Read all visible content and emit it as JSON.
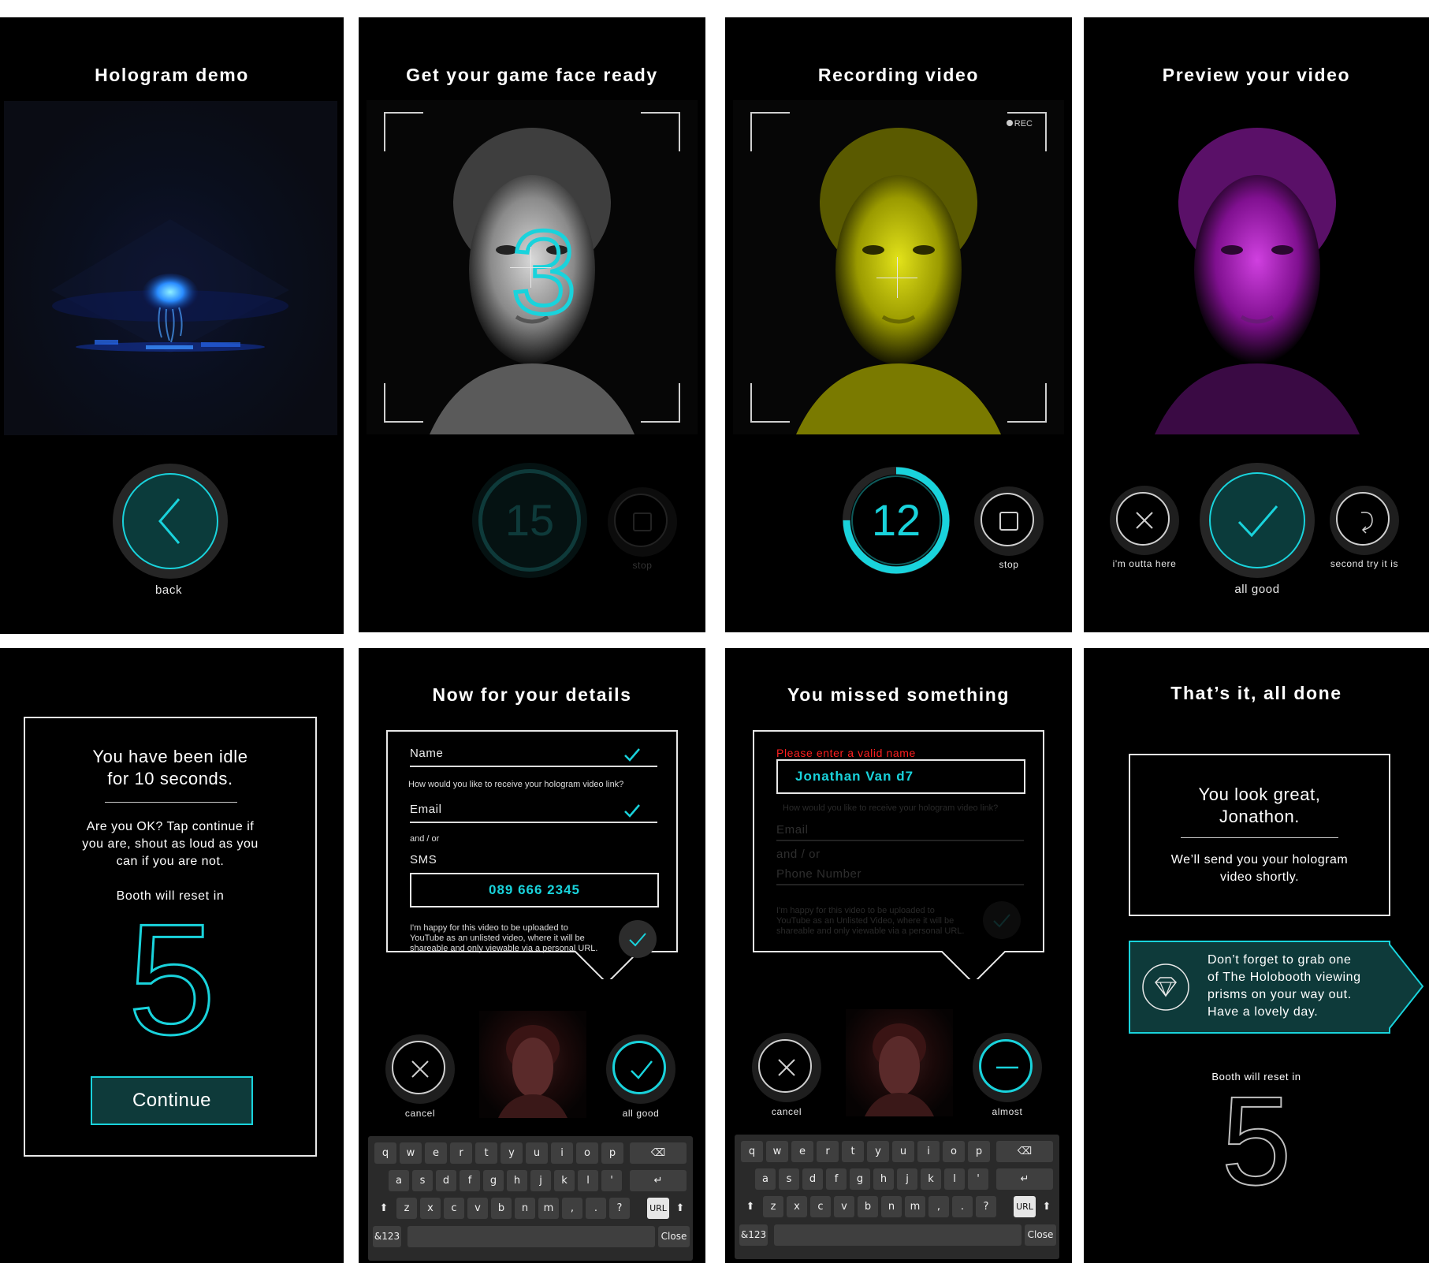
{
  "colors": {
    "accent": "#19d3dc",
    "dark_teal": "#0e3a3a",
    "error": "#ff2020",
    "panel": "#000000",
    "yellow_tint": "#c8c800",
    "magenta_tint": "#b020c0"
  },
  "screen1": {
    "title": "Hologram demo",
    "back_label": "back",
    "icon": "chevron-left-icon"
  },
  "screen2": {
    "title": "Get your game face ready",
    "countdown": "3",
    "timer": "15",
    "stop_label": "stop"
  },
  "screen3": {
    "title": "Recording video",
    "rec_label": "REC",
    "timer": "12",
    "timer_progress": 0.75,
    "stop_label": "stop"
  },
  "screen4": {
    "title": "Preview your video",
    "reject_label": "i'm outta here",
    "accept_label": "all good",
    "retry_label": "second try it is"
  },
  "screen5": {
    "heading": "You have been idle\nfor 10 seconds.",
    "message": "Are you OK? Tap continue if\nyou are, shout as loud as you\ncan if you are not.",
    "reset_label": "Booth will reset in",
    "countdown": "5",
    "continue_label": "Continue"
  },
  "screen6": {
    "title": "Now for your details",
    "name_label": "Name",
    "question": "How would you like to receive your hologram video link?",
    "email_label": "Email",
    "and_or": "and / or",
    "sms_label": "SMS",
    "sms_value": "089 666 2345",
    "consent": "I'm happy for this video to be uploaded to\nYouTube as an unlisted video, where it will be\nshareable and only viewable via a personal URL.",
    "cancel_label": "cancel",
    "confirm_label": "all good"
  },
  "screen7": {
    "title": "You missed something",
    "error": "Please enter a valid name",
    "name_value": "Jonathan Van d7",
    "question": "How would you like to receive your hologram video link?",
    "email_label": "Email",
    "and_or": "and / or",
    "phone_label": "Phone Number",
    "consent": "I'm happy for this video to be uploaded to\nYouTube as an Unlisted Video, where it will be\nshareable and only viewable via a personal URL.",
    "cancel_label": "cancel",
    "almost_label": "almost"
  },
  "keyboard": {
    "row1": [
      "q",
      "w",
      "e",
      "r",
      "t",
      "y",
      "u",
      "i",
      "o",
      "p"
    ],
    "row2": [
      "a",
      "s",
      "d",
      "f",
      "g",
      "h",
      "j",
      "k",
      "l",
      "'"
    ],
    "row3": [
      "z",
      "x",
      "c",
      "v",
      "b",
      "n",
      "m",
      ",",
      ".",
      "?"
    ],
    "url": "URL",
    "num": "&123",
    "close": "Close",
    "backspace": "⌫",
    "enter": "↵",
    "shift": "⬆"
  },
  "screen8": {
    "title": "That’s it, all done",
    "greeting": "You look great,\nJonathon.",
    "message": "We’ll send you your hologram\nvideo shortly.",
    "tip": "Don’t forget to grab one\nof The Holobooth viewing\nprisms on your way out.\nHave a lovely day.",
    "tip_icon": "diamond-icon",
    "reset_label": "Booth will reset in",
    "countdown": "5"
  }
}
